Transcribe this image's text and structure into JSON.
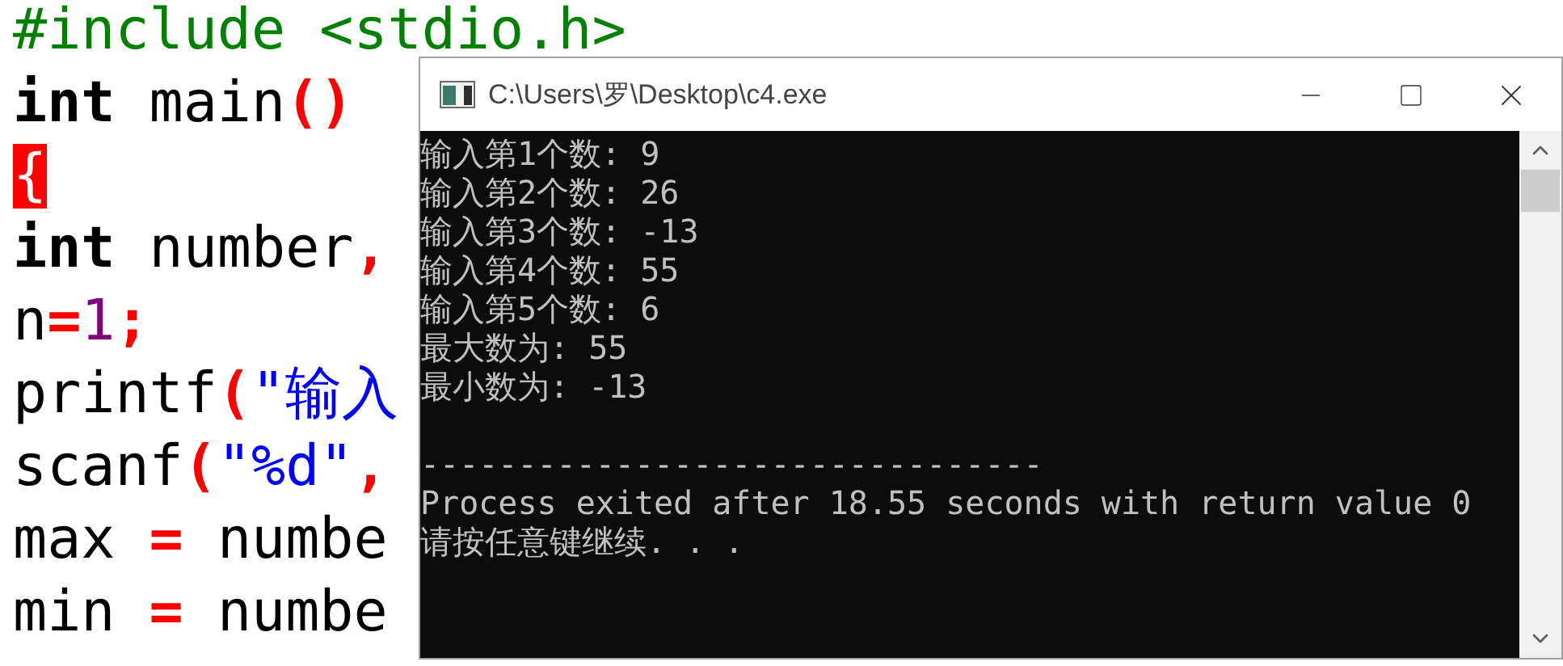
{
  "editor": {
    "lines": [
      [
        {
          "text": "#include <stdio.h>",
          "kind": "preprocessor"
        }
      ],
      [
        {
          "text": "int",
          "kind": "keyword"
        },
        {
          "text": " main",
          "kind": "plain"
        },
        {
          "text": "()",
          "kind": "operator"
        }
      ],
      [
        {
          "text": "{",
          "kind": "matched-brace"
        }
      ],
      [
        {
          "text": "int",
          "kind": "keyword"
        },
        {
          "text": " number",
          "kind": "plain"
        },
        {
          "text": ",",
          "kind": "operator"
        }
      ],
      [
        {
          "text": "n",
          "kind": "plain"
        },
        {
          "text": "=",
          "kind": "operator"
        },
        {
          "text": "1",
          "kind": "number"
        },
        {
          "text": ";",
          "kind": "operator"
        }
      ],
      [
        {
          "text": "printf",
          "kind": "plain"
        },
        {
          "text": "(",
          "kind": "operator"
        },
        {
          "text": "\"输入",
          "kind": "string"
        }
      ],
      [
        {
          "text": "scanf",
          "kind": "plain"
        },
        {
          "text": "(",
          "kind": "operator"
        },
        {
          "text": "\"%d\"",
          "kind": "string"
        },
        {
          "text": ",",
          "kind": "operator"
        }
      ],
      [
        {
          "text": "max ",
          "kind": "plain"
        },
        {
          "text": "=",
          "kind": "operator"
        },
        {
          "text": " numbe",
          "kind": "plain"
        }
      ],
      [
        {
          "text": "min ",
          "kind": "plain"
        },
        {
          "text": "=",
          "kind": "operator"
        },
        {
          "text": " numbe",
          "kind": "plain"
        }
      ]
    ]
  },
  "console": {
    "title": "C:\\Users\\罗\\Desktop\\c4.exe",
    "output_lines": [
      "输入第1个数: 9",
      "输入第2个数: 26",
      "输入第3个数: -13",
      "输入第4个数: 55",
      "输入第5个数: 6",
      "最大数为: 55",
      "最小数为: -13"
    ],
    "separator": "--------------------------------",
    "exit_message": "Process exited after 18.55 seconds with return value 0",
    "prompt": "请按任意键继续. . ."
  }
}
